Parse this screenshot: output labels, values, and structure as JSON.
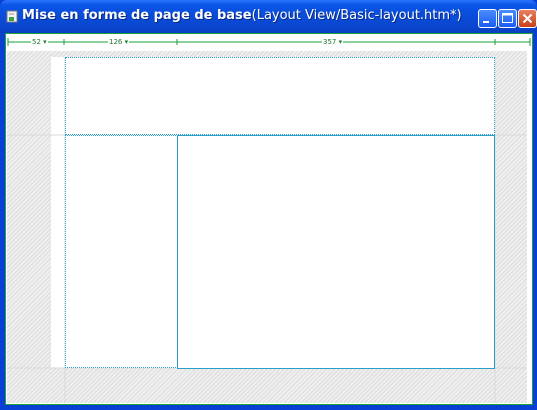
{
  "window": {
    "title_main": "Mise en forme de page de base",
    "title_path": "(Layout View/Basic-layout.htm*)",
    "icons": {
      "app": "page-icon",
      "minimize": "minimize-icon",
      "maximize": "maximize-icon",
      "close": "close-icon"
    }
  },
  "ruler": {
    "col1": "52 ▾",
    "col2": "126 ▾",
    "col3": "357 ▾"
  },
  "colors": {
    "titlebar": "#0a4bd8",
    "ruler_green": "#1aa13a",
    "cell_border": "#2aa0c8",
    "close_button": "#c8401a"
  }
}
